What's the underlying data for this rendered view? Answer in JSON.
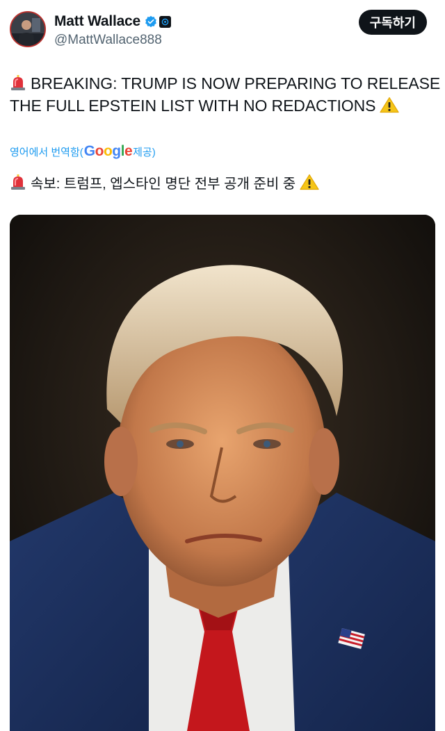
{
  "author": {
    "display_name": "Matt Wallace",
    "handle": "@MattWallace888",
    "verified_icon": "verified-badge-icon",
    "affiliate_icon": "affiliate-badge-icon",
    "verified_color": "#1d9bf0"
  },
  "subscribe_label": "구독하기",
  "tweet": {
    "text_line1": "BREAKING: TRUMP IS NOW PREPARING TO RELEASE",
    "text_line2": "THE FULL EPSTEIN LIST WITH NO REDACTIONS",
    "leading_emoji": "siren-emoji",
    "trailing_emoji": "warning-emoji"
  },
  "translation": {
    "prefix": "영어에서 번역함(",
    "provider": "Google",
    "suffix": " 제공)",
    "text": "속보: 트럼프, 엡스타인 명단 전부 공개 준비 중",
    "link_color": "#1d9bf0"
  },
  "media": {
    "type": "photo",
    "subject": "portrait"
  }
}
